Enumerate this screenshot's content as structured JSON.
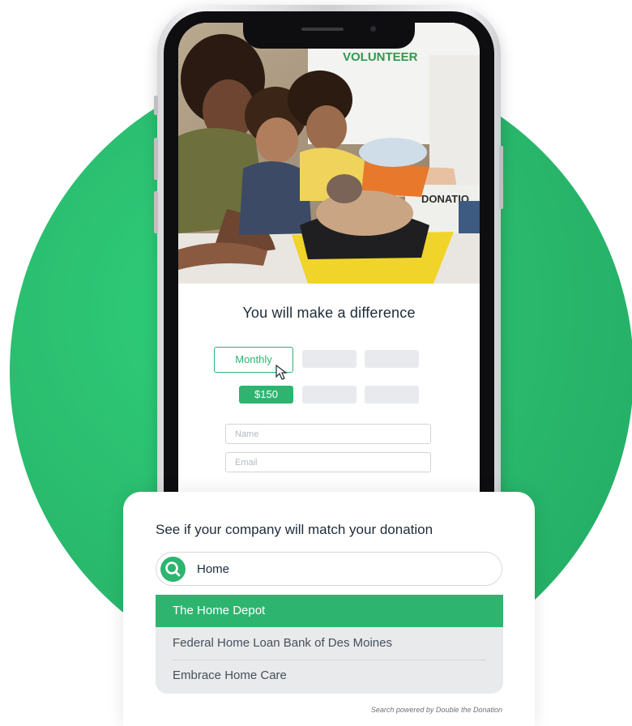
{
  "form": {
    "title": "You will make a difference",
    "frequency_selected": "Monthly",
    "amount_selected": "$150",
    "name_placeholder": "Name",
    "email_placeholder": "Email"
  },
  "photo": {
    "shirt_text": "VOLUNTEER",
    "box_text": "DONATIO"
  },
  "matching": {
    "title": "See if your company will match your donation",
    "search_value": "Home",
    "results": [
      "The Home Depot",
      "Federal Home Loan Bank of Des Moines",
      "Embrace Home Care"
    ],
    "powered_by": "Search powered by Double the Donation"
  },
  "colors": {
    "accent": "#2db570",
    "background_circle": "#29b86c",
    "title_text": "#1d2b3a"
  },
  "icons": [
    "search-icon",
    "cursor-icon"
  ]
}
